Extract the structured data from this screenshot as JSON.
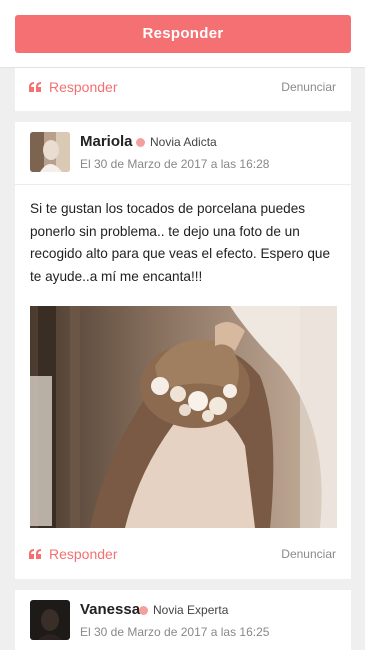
{
  "header": {
    "reply_button": "Responder"
  },
  "post_actions": {
    "reply": "Responder",
    "report": "Denunciar"
  },
  "posts": [
    {
      "author": "Mariola",
      "level": "Novia Adicta",
      "date": "El 30 de Marzo de 2017 a las 16:28",
      "body": "Si te gustan los tocados de porcelana puedes ponerlo sin problema.. te dejo una foto de un recogido alto para que veas el efecto. Espero que te ayude..a mí me encanta!!!"
    },
    {
      "author": "Vanessa",
      "level": "Novia Experta",
      "date": "El 30 de Marzo de 2017 a las 16:25"
    }
  ],
  "colors": {
    "accent": "#f47072",
    "level_dot": "#f3a09c"
  },
  "icons": {
    "quote": "quote-icon",
    "level": "level-dot-icon"
  }
}
